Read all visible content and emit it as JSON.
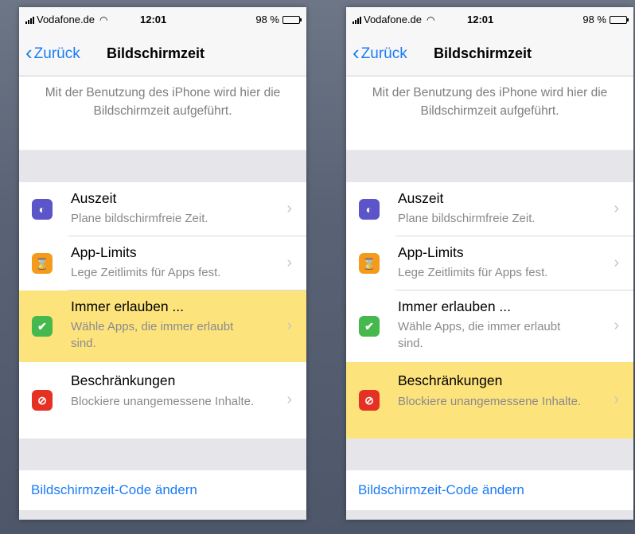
{
  "screens": [
    {
      "status": {
        "carrier": "Vodafone.de",
        "time": "12:01",
        "battery": "98 %"
      },
      "nav": {
        "back_label": "Zurück",
        "title": "Bildschirmzeit"
      },
      "info_text": "Mit der Benutzung des iPhone wird hier die Bildschirmzeit aufgeführt.",
      "rows": [
        {
          "title": "Auszeit",
          "subtitle": "Plane bildschirmfreie Zeit.",
          "icon": "downtime-icon",
          "highlighted": false
        },
        {
          "title": "App-Limits",
          "subtitle": "Lege Zeitlimits für Apps fest.",
          "icon": "hourglass-icon",
          "highlighted": false
        },
        {
          "title": "Immer erlauben ...",
          "subtitle": "Wähle Apps, die immer erlaubt sind.",
          "icon": "checkmark-badge-icon",
          "highlighted": true
        },
        {
          "title": "Beschränkungen",
          "subtitle": "Blockiere unangemessene Inhalte.",
          "icon": "restriction-icon",
          "highlighted": false
        }
      ],
      "code_link": "Bildschirmzeit-Code ändern"
    },
    {
      "status": {
        "carrier": "Vodafone.de",
        "time": "12:01",
        "battery": "98 %"
      },
      "nav": {
        "back_label": "Zurück",
        "title": "Bildschirmzeit"
      },
      "info_text": "Mit der Benutzung des iPhone wird hier die Bildschirmzeit aufgeführt.",
      "rows": [
        {
          "title": "Auszeit",
          "subtitle": "Plane bildschirmfreie Zeit.",
          "icon": "downtime-icon",
          "highlighted": false
        },
        {
          "title": "App-Limits",
          "subtitle": "Lege Zeitlimits für Apps fest.",
          "icon": "hourglass-icon",
          "highlighted": false
        },
        {
          "title": "Immer erlauben ...",
          "subtitle": "Wähle Apps, die immer erlaubt sind.",
          "icon": "checkmark-badge-icon",
          "highlighted": false
        },
        {
          "title": "Beschränkungen",
          "subtitle": "Blockiere unangemessene Inhalte.",
          "icon": "restriction-icon",
          "highlighted": true
        }
      ],
      "code_link": "Bildschirmzeit-Code ändern"
    }
  ],
  "colors": {
    "accent": "#1a7cf5",
    "highlight": "#fce37c",
    "downtime": "#5b55c9",
    "app_limits": "#f59b1c",
    "always_allowed": "#45b94d",
    "restrictions": "#e53124"
  }
}
